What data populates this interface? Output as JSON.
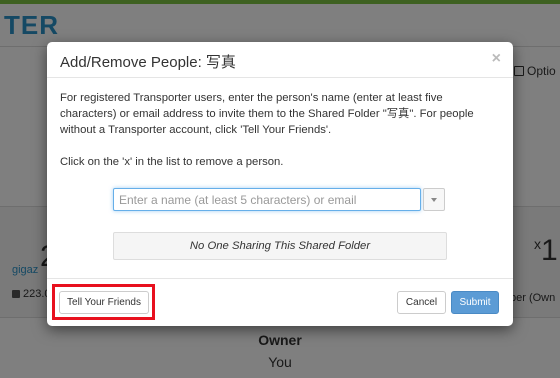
{
  "background": {
    "logo": "TER",
    "options_label": "Optio",
    "count_left": "2",
    "user_label": "gigaz",
    "size_label": "223.0",
    "count_right": "1",
    "count_right_sup": "x",
    "member_label": "ber (Own",
    "owner_label": "Owner",
    "you_label": "You"
  },
  "modal": {
    "title": "Add/Remove People: 写真",
    "close_symbol": "×",
    "instructions": "For registered Transporter users, enter the person's name (enter at least five characters) or email address to invite them to the Shared Folder \"写真\". For people without a Transporter account, click 'Tell Your Friends'.",
    "remove_hint": "Click on the 'x' in the list to remove a person.",
    "search": {
      "value": "",
      "placeholder": "Enter a name (at least 5 characters) or email"
    },
    "empty_list_text": "No One Sharing This Shared Folder",
    "buttons": {
      "tell_friends": "Tell Your Friends",
      "cancel": "Cancel",
      "submit": "Submit"
    }
  },
  "colors": {
    "accent_blue": "#5b9bd5",
    "highlight_red": "#e8101e",
    "focus_blue": "#66afe9",
    "brand_blue": "#2a93c9",
    "top_green": "#7cc242"
  }
}
